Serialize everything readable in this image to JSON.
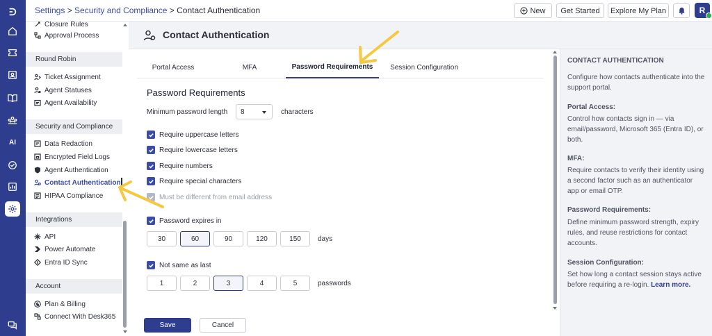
{
  "header": {
    "breadcrumb": {
      "root": "Settings",
      "sep1": " > ",
      "section": "Security and Compliance",
      "sep2": " > ",
      "current": "Contact Authentication"
    },
    "new_label": "New",
    "get_started_label": "Get Started",
    "explore_label": "Explore My Plan",
    "avatar_initial": "R"
  },
  "rail": {
    "ai_label": "AI"
  },
  "sidebar": {
    "items_top": [
      "Closure Rules",
      "Approval Process"
    ],
    "sections": {
      "round_robin": "Round Robin",
      "security": "Security and Compliance",
      "integrations": "Integrations",
      "account": "Account"
    },
    "round_robin_items": [
      "Ticket Assignment",
      "Agent Statuses",
      "Agent Availability"
    ],
    "security_items": [
      "Data Redaction",
      "Encrypted Field Logs",
      "Agent Authentication",
      "Contact Authentication",
      "HIPAA Compliance"
    ],
    "integration_items": [
      "API",
      "Power Automate",
      "Entra ID Sync"
    ],
    "account_items": [
      "Plan & Billing",
      "Connect With Desk365"
    ]
  },
  "main": {
    "title": "Contact Authentication",
    "tabs": [
      "Portal Access",
      "MFA",
      "Password Requirements",
      "Session Configuration"
    ],
    "active_tab": "Password Requirements",
    "section_title": "Password Requirements",
    "min_length_label": "Minimum password length",
    "min_length_value": "8",
    "characters_label": "characters",
    "checks": [
      {
        "label": "Require uppercase letters",
        "checked": true
      },
      {
        "label": "Require lowercase letters",
        "checked": true
      },
      {
        "label": "Require numbers",
        "checked": true
      },
      {
        "label": "Require special characters",
        "checked": true
      },
      {
        "label": "Must be different from email address",
        "checked": true,
        "disabled": true
      }
    ],
    "expires": {
      "label": "Password expires in",
      "checked": true,
      "options": [
        "30",
        "60",
        "90",
        "120",
        "150"
      ],
      "selected": "60",
      "unit": "days"
    },
    "not_same": {
      "label": "Not same as last",
      "checked": true,
      "options": [
        "1",
        "2",
        "3",
        "4",
        "5"
      ],
      "selected": "3",
      "unit": "passwords"
    }
  },
  "footer": {
    "save_label": "Save",
    "cancel_label": "Cancel"
  },
  "help": {
    "title": "CONTACT AUTHENTICATION",
    "intro": "Configure how contacts authenticate into the support portal.",
    "portal_heading": "Portal Access:",
    "portal_text": "Control how contacts sign in — via email/password, Microsoft 365 (Entra ID), or both.",
    "mfa_heading": "MFA:",
    "mfa_text": "Require contacts to verify their identity using a second factor such as an authenticator app or email OTP.",
    "password_heading": "Password Requirements:",
    "password_text": "Define minimum password strength, expiry rules, and reuse restrictions for contact accounts.",
    "session_heading": "Session Configuration:",
    "session_text": "Set how long a contact session stays active before requiring a re-login.",
    "learn_more": "Learn more."
  },
  "colors": {
    "brand": "#2f3d8f",
    "accent": "#3a4ca8",
    "arrow": "#f5c842",
    "status_online": "#2fa84f"
  }
}
